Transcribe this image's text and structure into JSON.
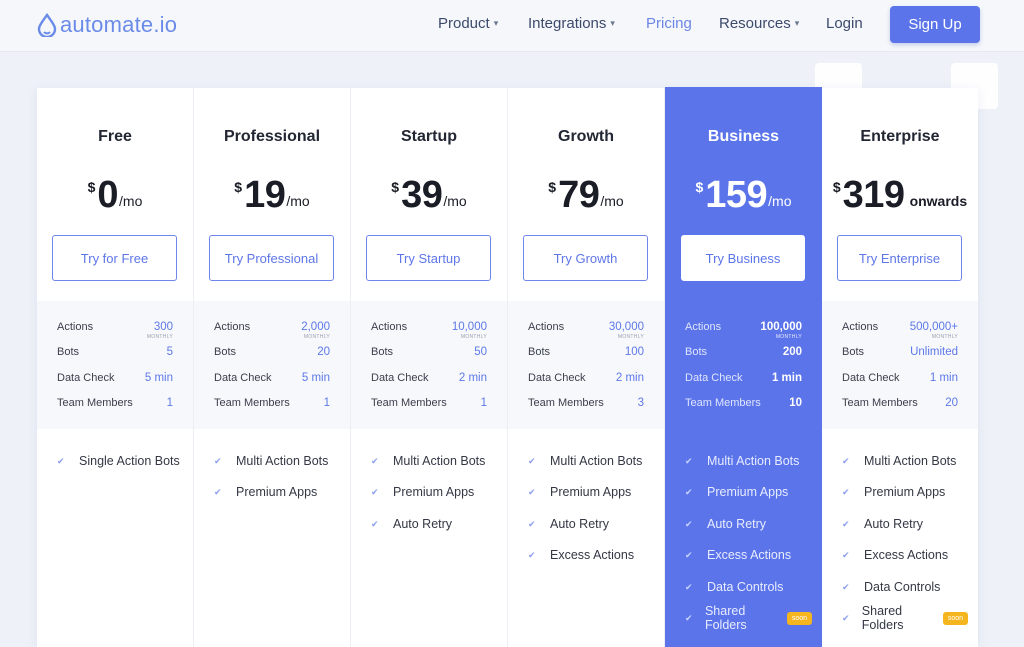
{
  "header": {
    "logo_text": "automate.io",
    "nav": [
      {
        "label": "Product",
        "has_menu": true
      },
      {
        "label": "Integrations",
        "has_menu": true
      },
      {
        "label": "Pricing",
        "has_menu": false,
        "active": true
      },
      {
        "label": "Resources",
        "has_menu": true
      },
      {
        "label": "Login",
        "has_menu": false
      }
    ],
    "signup_label": "Sign Up"
  },
  "colors": {
    "accent": "#5b74ea",
    "badge": "#f5b51e"
  },
  "plans": [
    {
      "name": "Free",
      "currency": "$",
      "amount": "0",
      "period": "/mo",
      "cta": "Try for Free",
      "stats": {
        "actions_label": "Actions",
        "actions": "300",
        "actions_sub": "MONTHLY",
        "bots_label": "Bots",
        "bots": "5",
        "check_label": "Data Check",
        "check": "5 min",
        "team_label": "Team Members",
        "team": "1"
      },
      "features": [
        {
          "label": "Single Action Bots"
        }
      ]
    },
    {
      "name": "Professional",
      "currency": "$",
      "amount": "19",
      "period": "/mo",
      "cta": "Try Professional",
      "stats": {
        "actions_label": "Actions",
        "actions": "2,000",
        "actions_sub": "MONTHLY",
        "bots_label": "Bots",
        "bots": "20",
        "check_label": "Data Check",
        "check": "5 min",
        "team_label": "Team Members",
        "team": "1"
      },
      "features": [
        {
          "label": "Multi Action Bots"
        },
        {
          "label": "Premium Apps"
        }
      ]
    },
    {
      "name": "Startup",
      "currency": "$",
      "amount": "39",
      "period": "/mo",
      "cta": "Try Startup",
      "stats": {
        "actions_label": "Actions",
        "actions": "10,000",
        "actions_sub": "MONTHLY",
        "bots_label": "Bots",
        "bots": "50",
        "check_label": "Data Check",
        "check": "2 min",
        "team_label": "Team Members",
        "team": "1"
      },
      "features": [
        {
          "label": "Multi Action Bots"
        },
        {
          "label": "Premium Apps"
        },
        {
          "label": "Auto Retry"
        }
      ]
    },
    {
      "name": "Growth",
      "currency": "$",
      "amount": "79",
      "period": "/mo",
      "cta": "Try Growth",
      "stats": {
        "actions_label": "Actions",
        "actions": "30,000",
        "actions_sub": "MONTHLY",
        "bots_label": "Bots",
        "bots": "100",
        "check_label": "Data Check",
        "check": "2 min",
        "team_label": "Team Members",
        "team": "3"
      },
      "features": [
        {
          "label": "Multi Action Bots"
        },
        {
          "label": "Premium Apps"
        },
        {
          "label": "Auto Retry"
        },
        {
          "label": "Excess Actions"
        }
      ]
    },
    {
      "name": "Business",
      "currency": "$",
      "amount": "159",
      "period": "/mo",
      "cta": "Try Business",
      "stats": {
        "actions_label": "Actions",
        "actions": "100,000",
        "actions_sub": "MONTHLY",
        "bots_label": "Bots",
        "bots": "200",
        "check_label": "Data Check",
        "check": "1 min",
        "team_label": "Team Members",
        "team": "10"
      },
      "features": [
        {
          "label": "Multi Action Bots"
        },
        {
          "label": "Premium Apps"
        },
        {
          "label": "Auto Retry"
        },
        {
          "label": "Excess Actions"
        },
        {
          "label": "Data Controls"
        },
        {
          "label": "Shared Folders",
          "badge": "soon"
        }
      ]
    },
    {
      "name": "Enterprise",
      "currency": "$",
      "amount": "319",
      "period": "onwards",
      "cta": "Try Enterprise",
      "stats": {
        "actions_label": "Actions",
        "actions": "500,000+",
        "actions_sub": "MONTHLY",
        "bots_label": "Bots",
        "bots": "Unlimited",
        "check_label": "Data Check",
        "check": "1 min",
        "team_label": "Team Members",
        "team": "20"
      },
      "features": [
        {
          "label": "Multi Action Bots"
        },
        {
          "label": "Premium Apps"
        },
        {
          "label": "Auto Retry"
        },
        {
          "label": "Excess Actions"
        },
        {
          "label": "Data Controls"
        },
        {
          "label": "Shared Folders",
          "badge": "soon"
        }
      ]
    }
  ]
}
